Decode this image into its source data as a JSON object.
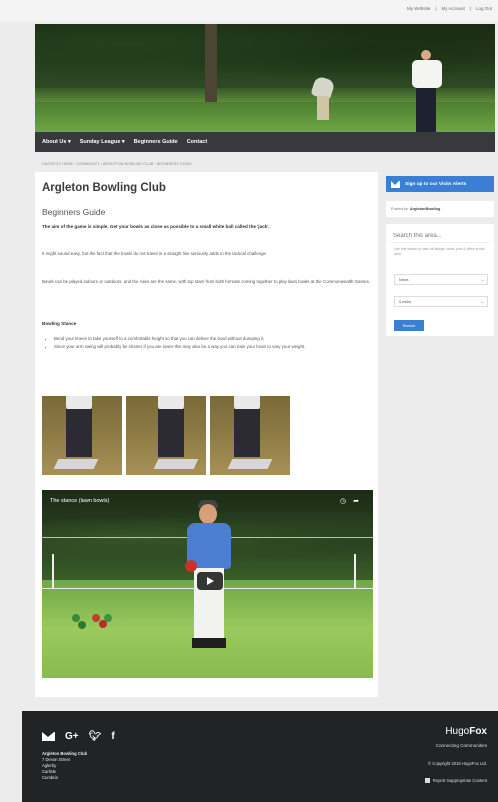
{
  "top_links": [
    "My Website",
    "|",
    "My Account",
    "|",
    "Log Out"
  ],
  "nav": {
    "items": [
      "About Us ▾",
      "Sunday League ▾",
      "Beginners Guide",
      "Contact"
    ]
  },
  "breadcrumb": "HUGOFOX HOME › COMMUNITY › ARGLETON BOWLING CLUB › BEGINNERS GUIDE",
  "page": {
    "title": "Argleton Bowling Club",
    "subtitle": "Beginners Guide",
    "intro": "The aim of the game is simple. Get your bowls as close as possible to a small white ball called the 'jack'.",
    "para1": "It might sound easy, but the fact that the bowls do not travel in a straight line seriously adds to the tactical challenge.",
    "para2": "Bowls can be played indoors or outdoors, and the rules are the same, with top stars from both formats coming together to play lawn bowls at the Commonwealth Games.",
    "stance_heading": "Bowling Stance",
    "bullets": [
      "Bend your knees to take yourself to a comfortable height so that you can deliver the bowl without dumping it.",
      "Since your arm swing will probably be shorter if you are lower this may also be a way you can train your brain to vary your weight."
    ]
  },
  "video": {
    "title": "The stance (lawn bowls)",
    "clock_icon": "clock-icon",
    "share_icon": "share-icon"
  },
  "sidebar": {
    "signup_label": "Sign up to our Visits Alerts",
    "follow_prefix": "Posted by",
    "follow_name": "ArgletonBowling",
    "search_placeholder": "Search this area...",
    "search_help": "Use this search to view all listings, news, pics & offers in this area",
    "select1": "News",
    "select2": "5 miles",
    "search_button": "Search"
  },
  "footer": {
    "club_name": "Argleton Bowling Club",
    "address_lines": [
      "7 Devon Street",
      "Aglerby",
      "Carlisle",
      "Cumbria"
    ],
    "brand_a": "Hugo",
    "brand_b": "Fox",
    "tagline": "Connecting Communities",
    "copyright": "© Copyright 2016 HugoFox Ltd.",
    "report": "Report Inappropriate Content"
  },
  "colors": {
    "accent": "#3b7fd4",
    "nav_bg": "#37393d",
    "footer_bg": "#222325"
  }
}
